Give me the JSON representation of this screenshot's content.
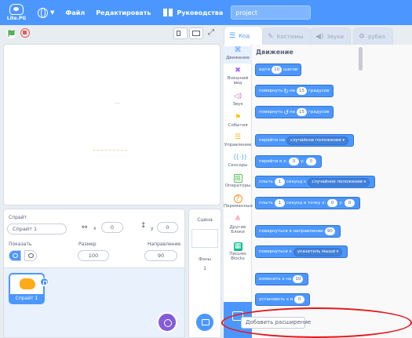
{
  "menubar": {
    "logo_text": "Lite.PG",
    "menu_file": "Файл",
    "menu_edit": "Редактировать",
    "tutorials": "Руководства",
    "project_title": "project"
  },
  "tabs": {
    "code": "Код",
    "costumes": "Костюмы",
    "sounds": "Звуки",
    "extra": "рубил"
  },
  "sprite_info": {
    "sprite_label": "Спрайт",
    "sprite_name": "Спрайт 1",
    "x_label": "x",
    "x_value": "0",
    "y_label": "y",
    "y_value": "0",
    "show_label": "Показать",
    "size_label": "Размер",
    "size_value": "100",
    "direction_label": "Направление",
    "direction_value": "90"
  },
  "sprite_list": {
    "items": [
      {
        "name": "Спрайт 1"
      }
    ]
  },
  "stage_pane": {
    "title": "Сцена",
    "backdrops_label": "Фоны",
    "backdrops_count": "1"
  },
  "categories": [
    {
      "label": "Движение",
      "color": "#4c97ff"
    },
    {
      "label": "Внешний вид",
      "color": "#9966ff"
    },
    {
      "label": "Звук",
      "color": "#cf63cf"
    },
    {
      "label": "События",
      "color": "#ffbf00"
    },
    {
      "label": "Управление",
      "color": "#ffab19"
    },
    {
      "label": "Сенсоры",
      "color": "#5cb1d6"
    },
    {
      "label": "Операторы",
      "color": "#59c059"
    },
    {
      "label": "Переменные",
      "color": "#ff8c1a"
    },
    {
      "label": "Другие Блоки",
      "color": "#ff6680"
    },
    {
      "label": "Письмо Blocks",
      "color": "#0fbd8c"
    }
  ],
  "flyout": {
    "title": "Движение",
    "blocks": {
      "move": {
        "pre": "идти",
        "val": "10",
        "post": "шагов"
      },
      "turn_right": {
        "pre": "повернуть",
        "mid": "на",
        "val": "15",
        "post": "градусов"
      },
      "turn_left": {
        "pre": "повернуть",
        "mid": "на",
        "val": "15",
        "post": "градусов"
      },
      "goto": {
        "pre": "перейти на",
        "drop": "случайное положение"
      },
      "goto_xy": {
        "pre": "перейти в x:",
        "x": "0",
        "ymid": "y:",
        "y": "0"
      },
      "glide": {
        "pre": "плыть",
        "val": "1",
        "mid": "секунд к",
        "drop": "случайное положение"
      },
      "glide_xy": {
        "pre": "плыть",
        "val": "1",
        "mid": "секунд в точку x:",
        "x": "0",
        "ymid": "y:",
        "y": "0"
      },
      "point_dir": {
        "pre": "повернуться в направлении",
        "val": "90"
      },
      "point_towards": {
        "pre": "повернуться к",
        "drop": "указатель мыши"
      },
      "change_x": {
        "pre": "изменить x на",
        "val": "10"
      },
      "set_x": {
        "pre": "установить x в",
        "val": "0"
      }
    }
  },
  "tooltip": {
    "add_extension": "Добавить расширение"
  }
}
